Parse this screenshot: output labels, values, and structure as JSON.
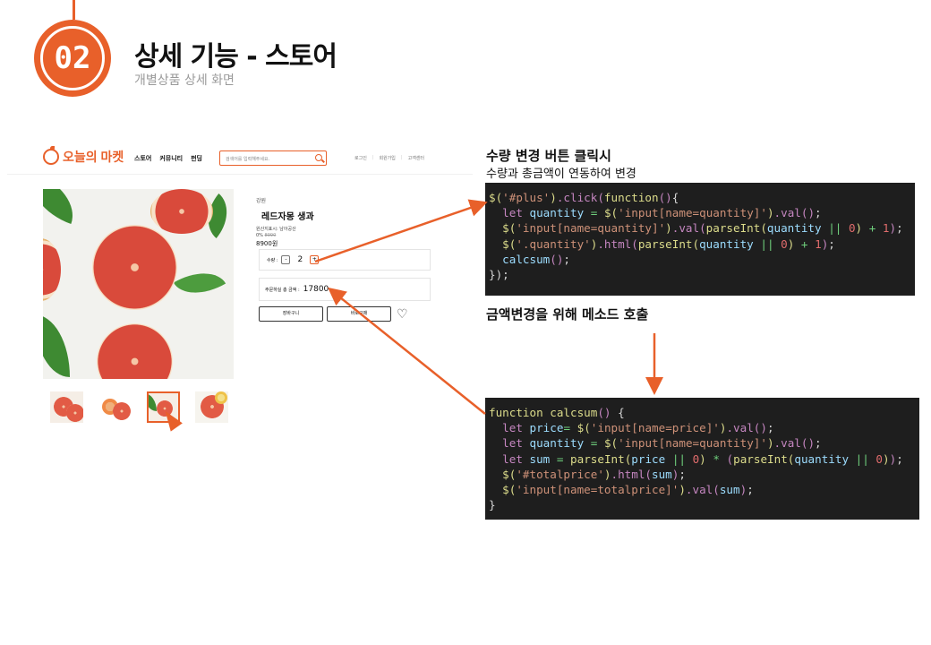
{
  "header": {
    "badge_number": "02",
    "title": "상세 기능 - 스토어",
    "subtitle": "개별상품 상세 화면"
  },
  "site": {
    "logo_text": "오늘의 마켓",
    "menu": [
      "스토어",
      "커뮤니티",
      "펀딩"
    ],
    "search_placeholder": "검색어를 입력해주세요.",
    "util_links": [
      "로그인",
      "회원가입",
      "고객센터"
    ],
    "brand": "강원",
    "product_name": "레드자몽 생과",
    "origin": "원산지표시: 남아공산",
    "discount_rate": "0%",
    "original_price": "8990",
    "price": "8900원",
    "quantity_label": "수량 :",
    "minus_label": "-",
    "quantity": "2",
    "plus_label": "+",
    "total_label": "주문하실 총 금액 :",
    "total_price": "17800",
    "cart_button": "장바구니",
    "buy_button": "바로구매"
  },
  "annotations": {
    "click_title": "수량 변경 버튼 클릭시",
    "click_subtitle": "수량과 총금액이 연동하여 변경",
    "method_call": "금액변경을 위해 메소드 호출"
  },
  "code1": [
    "$('#plus').click(function(){",
    "  let quantity = $('input[name=quantity]').val();",
    "  $('input[name=quantity]').val(parseInt(quantity || 0) + 1);",
    "  $('.quantity').html(parseInt(quantity || 0) + 1);",
    "  calcsum();",
    "});"
  ],
  "code2": [
    "function calcsum() {",
    "  let price= $('input[name=price]').val();",
    "  let quantity = $('input[name=quantity]').val();",
    "  let sum = parseInt(price || 0) * (parseInt(quantity || 0));",
    "  $('#totalprice').html(sum);",
    "  $('input[name=totalprice]').val(sum);",
    "}"
  ],
  "colors": {
    "accent": "#e8602a",
    "code_bg": "#1e1e1e"
  },
  "icons": [
    "search-icon",
    "heart-icon",
    "cursor-icon",
    "logo-icon"
  ]
}
